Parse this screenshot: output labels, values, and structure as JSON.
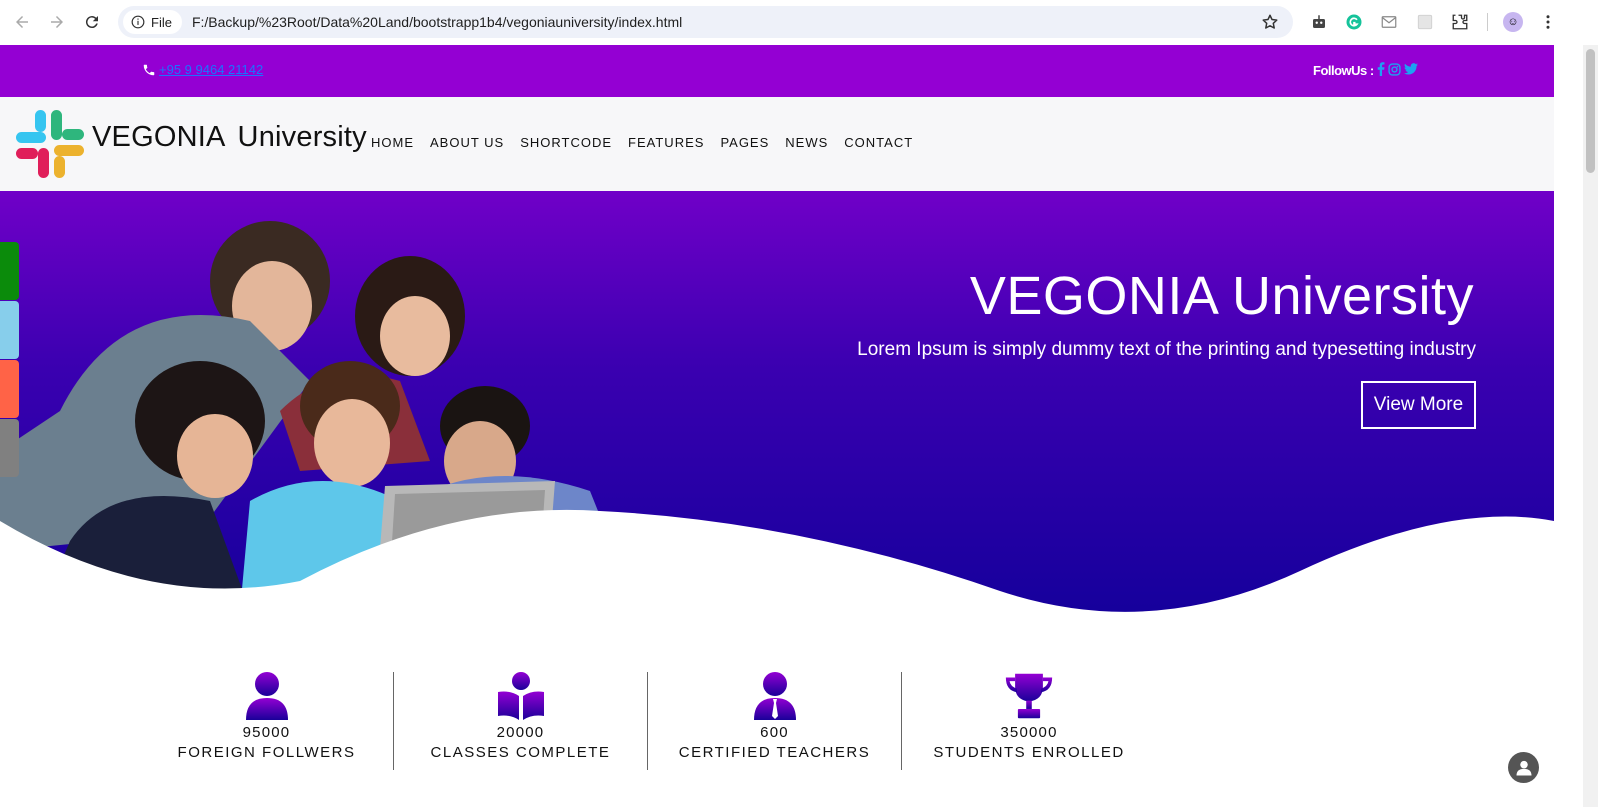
{
  "browser": {
    "chip_label": "File",
    "url": "F:/Backup/%23Root/Data%20Land/bootstrapp1b4/vegoniauniversity/index.html"
  },
  "topbar": {
    "phone": "+95 9 9464 21142",
    "follow_label": "FollowUs :",
    "social": [
      "facebook-icon",
      "instagram-icon",
      "twitter-icon"
    ]
  },
  "header": {
    "brand_main": "VEGONIA",
    "brand_sub": "University",
    "menu": [
      "HOME",
      "ABOUT US",
      "SHORTCODE",
      "FEATURES",
      "PAGES",
      "NEWS",
      "CONTACT"
    ]
  },
  "hero": {
    "title": "VEGONIA University",
    "subtitle": "Lorem Ipsum is simply dummy text of the printing and typesetting industry",
    "button": "View More"
  },
  "side_tabs": [
    "#0b8b0b",
    "#87ceeb",
    "#ff6347",
    "#808080"
  ],
  "stats": [
    {
      "icon": "user-icon",
      "value": "95000",
      "label": "FOREIGN FOLLWERS"
    },
    {
      "icon": "book-reader-icon",
      "value": "20000",
      "label": "CLASSES COMPLETE"
    },
    {
      "icon": "teacher-icon",
      "value": "600",
      "label": "CERTIFIED TEACHERS"
    },
    {
      "icon": "trophy-icon",
      "value": "350000",
      "label": "STUDENTS ENROLLED"
    }
  ],
  "colors": {
    "topbar": "#9400d3",
    "hero_top": "#7000c8",
    "hero_bottom": "#12009a",
    "icon_gradient_top": "#9400d3",
    "icon_gradient_bottom": "#1a0099"
  }
}
